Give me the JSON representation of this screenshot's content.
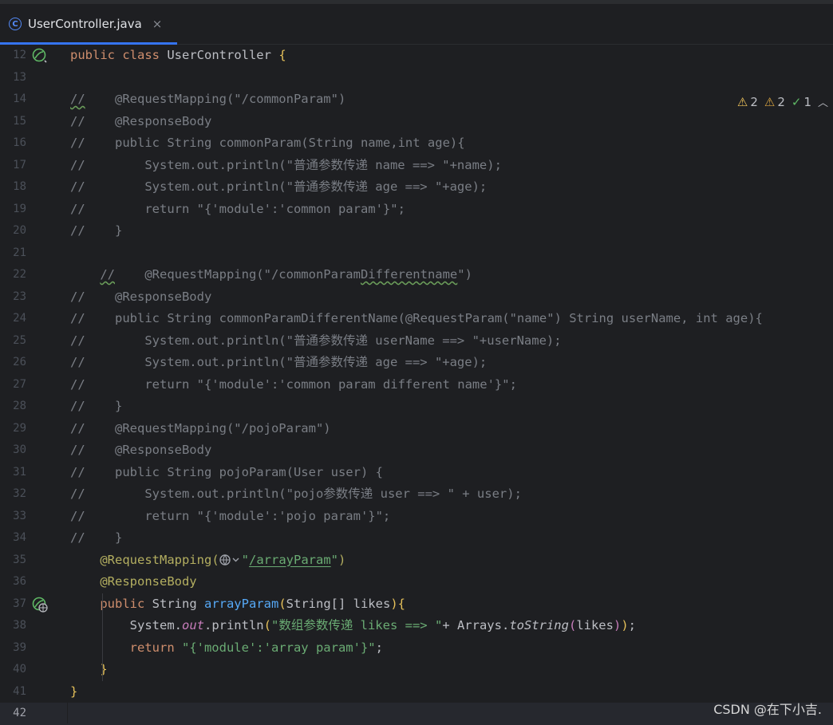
{
  "tab": {
    "title": "UserController.java",
    "icon": "class-icon",
    "close": "×"
  },
  "inspections": {
    "warnings": "2",
    "weak_warnings": "2",
    "typos": "1"
  },
  "watermark": "CSDN @在下小吉.",
  "lines": {
    "n12": "12",
    "n13": "13",
    "n14": "14",
    "n15": "15",
    "n16": "16",
    "n17": "17",
    "n18": "18",
    "n19": "19",
    "n20": "20",
    "n21": "21",
    "n22": "22",
    "n23": "23",
    "n24": "24",
    "n25": "25",
    "n26": "26",
    "n27": "27",
    "n28": "28",
    "n29": "29",
    "n30": "30",
    "n31": "31",
    "n32": "32",
    "n33": "33",
    "n34": "34",
    "n35": "35",
    "n36": "36",
    "n37": "37",
    "n38": "38",
    "n39": "39",
    "n40": "40",
    "n41": "41",
    "n42": "42"
  },
  "code": {
    "l12_kw": "public class ",
    "l12_name": "UserController ",
    "l12_brace": "{",
    "l14_slash": "//",
    "l14_rest": "    @RequestMapping(\"/commonParam\")",
    "l15": "//    @ResponseBody",
    "l16": "//    public String commonParam(String name,int age){",
    "l17": "//        System.out.println(\"普通参数传递 name ==> \"+name);",
    "l18": "//        System.out.println(\"普通参数传递 age ==> \"+age);",
    "l19": "//        return \"{'module':'common param'}\";",
    "l20": "//    }",
    "l22_indent": "    ",
    "l22_slash": "//",
    "l22_a": "    @RequestMapping(\"/commonParam",
    "l22_b": "Differentname",
    "l22_c": "\")",
    "l23": "//    @ResponseBody",
    "l24": "//    public String commonParamDifferentName(@RequestParam(\"name\") String userName, int age){",
    "l25": "//        System.out.println(\"普通参数传递 userName ==> \"+userName);",
    "l26": "//        System.out.println(\"普通参数传递 age ==> \"+age);",
    "l27": "//        return \"{'module':'common param different name'}\";",
    "l28": "//    }",
    "l29": "//    @RequestMapping(\"/pojoParam\")",
    "l30": "//    @ResponseBody",
    "l31": "//    public String pojoParam(User user) {",
    "l32": "//        System.out.println(\"pojo参数传递 user ==> \" + user);",
    "l33": "//        return \"{'module':'pojo param'}\";",
    "l34": "//    }",
    "l35_indent": "    ",
    "l35_ann": "@RequestMapping",
    "l35_paren": "(",
    "l35_q1": "\"",
    "l35_path": "/arrayParam",
    "l35_q2": "\"",
    "l35_close": ")",
    "l36": "    @ResponseBody",
    "l37_indent": "    ",
    "l37_kw": "public ",
    "l37_type": "String ",
    "l37_fn": "arrayParam",
    "l37_open": "(",
    "l37_params": "String[] likes",
    "l37_close": ")",
    "l37_brace": "{",
    "l38_indent": "        ",
    "l38_sys": "System.",
    "l38_out": "out",
    "l38_print": ".println",
    "l38_p1": "(",
    "l38_str": "\"数组参数传递 likes ==> \"",
    "l38_mid": "+ Arrays.",
    "l38_tostr": "toString",
    "l38_p2": "(",
    "l38_arg": "likes",
    "l38_p3": ")",
    "l38_p4": ")",
    "l38_semi": ";",
    "l39_indent": "        ",
    "l39_kw": "return ",
    "l39_str": "\"{'module':'array param'}\"",
    "l39_semi": ";",
    "l40": "    }",
    "l41": "}"
  },
  "colors": {
    "background": "#1e1f22",
    "keyword": "#cf8e6d",
    "comment": "#7a7e85",
    "annotation": "#b3ae60",
    "string": "#6aab73",
    "method": "#56a8f5",
    "field": "#c77dbb",
    "accent": "#3574f0"
  }
}
